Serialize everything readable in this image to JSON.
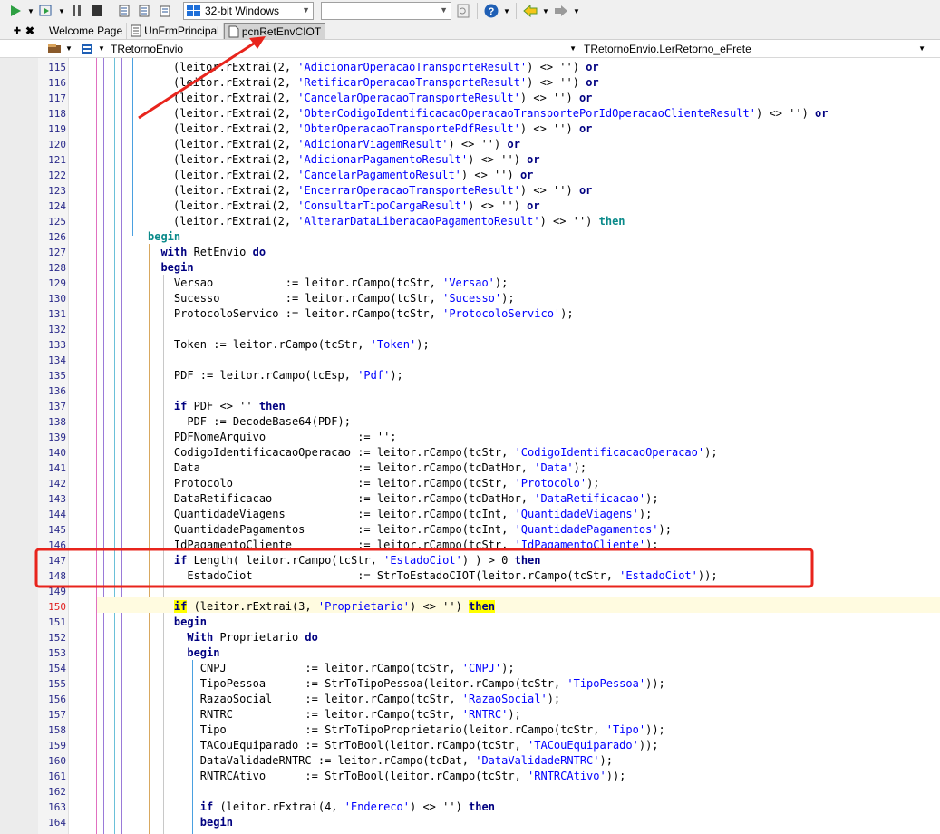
{
  "toolbar": {
    "platform": "32-bit Windows",
    "config_value": ""
  },
  "tabs": [
    {
      "label": "Welcome Page"
    },
    {
      "label": "UnFrmPrincipal"
    },
    {
      "label": "pcnRetEnvCIOT"
    }
  ],
  "navbar": {
    "class": "TRetornoEnvio",
    "method": "TRetornoEnvio.LerRetorno_eFrete"
  },
  "editor": {
    "line_numbers": [
      "115",
      "116",
      "117",
      "118",
      "119",
      "120",
      "121",
      "122",
      "123",
      "124",
      "125",
      "126",
      "127",
      "128",
      "129",
      "130",
      "131",
      "132",
      "133",
      "134",
      "135",
      "136",
      "137",
      "138",
      "139",
      "140",
      "141",
      "142",
      "143",
      "144",
      "145",
      "146",
      "147",
      "148",
      "149",
      "150",
      "151",
      "152",
      "153",
      "154",
      "155",
      "156",
      "157",
      "158",
      "159",
      "160",
      "161",
      "162",
      "163",
      "164"
    ],
    "lines": [
      [
        [
          "t",
          "(leitor.rExtrai(2, "
        ],
        [
          "s",
          "'AdicionarOperacaoTransporteResult'"
        ],
        [
          "t",
          ") <> '') "
        ],
        [
          "k",
          "or"
        ]
      ],
      [
        [
          "t",
          "(leitor.rExtrai(2, "
        ],
        [
          "s",
          "'RetificarOperacaoTransporteResult'"
        ],
        [
          "t",
          ") <> '') "
        ],
        [
          "k",
          "or"
        ]
      ],
      [
        [
          "t",
          "(leitor.rExtrai(2, "
        ],
        [
          "s",
          "'CancelarOperacaoTransporteResult'"
        ],
        [
          "t",
          ") <> '') "
        ],
        [
          "k",
          "or"
        ]
      ],
      [
        [
          "t",
          "(leitor.rExtrai(2, "
        ],
        [
          "s",
          "'ObterCodigoIdentificacaoOperacaoTransportePorIdOperacaoClienteResult'"
        ],
        [
          "t",
          ") <> '') "
        ],
        [
          "k",
          "or"
        ]
      ],
      [
        [
          "t",
          "(leitor.rExtrai(2, "
        ],
        [
          "s",
          "'ObterOperacaoTransportePdfResult'"
        ],
        [
          "t",
          ") <> '') "
        ],
        [
          "k",
          "or"
        ]
      ],
      [
        [
          "t",
          "(leitor.rExtrai(2, "
        ],
        [
          "s",
          "'AdicionarViagemResult'"
        ],
        [
          "t",
          ") <> '') "
        ],
        [
          "k",
          "or"
        ]
      ],
      [
        [
          "t",
          "(leitor.rExtrai(2, "
        ],
        [
          "s",
          "'AdicionarPagamentoResult'"
        ],
        [
          "t",
          ") <> '') "
        ],
        [
          "k",
          "or"
        ]
      ],
      [
        [
          "t",
          "(leitor.rExtrai(2, "
        ],
        [
          "s",
          "'CancelarPagamentoResult'"
        ],
        [
          "t",
          ") <> '') "
        ],
        [
          "k",
          "or"
        ]
      ],
      [
        [
          "t",
          "(leitor.rExtrai(2, "
        ],
        [
          "s",
          "'EncerrarOperacaoTransporteResult'"
        ],
        [
          "t",
          ") <> '') "
        ],
        [
          "k",
          "or"
        ]
      ],
      [
        [
          "t",
          "(leitor.rExtrai(2, "
        ],
        [
          "s",
          "'ConsultarTipoCargaResult'"
        ],
        [
          "t",
          ") <> '') "
        ],
        [
          "k",
          "or"
        ]
      ],
      [
        [
          "t",
          "(leitor.rExtrai(2, "
        ],
        [
          "s",
          "'AlterarDataLiberacaoPagamentoResult'"
        ],
        [
          "t",
          ") <> '') "
        ],
        [
          "c",
          "then"
        ]
      ],
      [
        [
          "c",
          "begin"
        ]
      ],
      [
        [
          "t",
          "  "
        ],
        [
          "k",
          "with"
        ],
        [
          "t",
          " RetEnvio "
        ],
        [
          "k",
          "do"
        ]
      ],
      [
        [
          "t",
          "  "
        ],
        [
          "k",
          "begin"
        ]
      ],
      [
        [
          "t",
          "    Versao           := leitor.rCampo(tcStr, "
        ],
        [
          "s",
          "'Versao'"
        ],
        [
          "t",
          ");"
        ]
      ],
      [
        [
          "t",
          "    Sucesso          := leitor.rCampo(tcStr, "
        ],
        [
          "s",
          "'Sucesso'"
        ],
        [
          "t",
          ");"
        ]
      ],
      [
        [
          "t",
          "    ProtocoloServico := leitor.rCampo(tcStr, "
        ],
        [
          "s",
          "'ProtocoloServico'"
        ],
        [
          "t",
          ");"
        ]
      ],
      [],
      [
        [
          "t",
          "    Token := leitor.rCampo(tcStr, "
        ],
        [
          "s",
          "'Token'"
        ],
        [
          "t",
          ");"
        ]
      ],
      [],
      [
        [
          "t",
          "    PDF := leitor.rCampo(tcEsp, "
        ],
        [
          "s",
          "'Pdf'"
        ],
        [
          "t",
          ");"
        ]
      ],
      [],
      [
        [
          "t",
          "    "
        ],
        [
          "k",
          "if"
        ],
        [
          "t",
          " PDF <> '' "
        ],
        [
          "k",
          "then"
        ]
      ],
      [
        [
          "t",
          "      PDF := DecodeBase64(PDF);"
        ]
      ],
      [
        [
          "t",
          "    PDFNomeArquivo              := '';"
        ]
      ],
      [
        [
          "t",
          "    CodigoIdentificacaoOperacao := leitor.rCampo(tcStr, "
        ],
        [
          "s",
          "'CodigoIdentificacaoOperacao'"
        ],
        [
          "t",
          ");"
        ]
      ],
      [
        [
          "t",
          "    Data                        := leitor.rCampo(tcDatHor, "
        ],
        [
          "s",
          "'Data'"
        ],
        [
          "t",
          ");"
        ]
      ],
      [
        [
          "t",
          "    Protocolo                   := leitor.rCampo(tcStr, "
        ],
        [
          "s",
          "'Protocolo'"
        ],
        [
          "t",
          ");"
        ]
      ],
      [
        [
          "t",
          "    DataRetificacao             := leitor.rCampo(tcDatHor, "
        ],
        [
          "s",
          "'DataRetificacao'"
        ],
        [
          "t",
          ");"
        ]
      ],
      [
        [
          "t",
          "    QuantidadeViagens           := leitor.rCampo(tcInt, "
        ],
        [
          "s",
          "'QuantidadeViagens'"
        ],
        [
          "t",
          ");"
        ]
      ],
      [
        [
          "t",
          "    QuantidadePagamentos        := leitor.rCampo(tcInt, "
        ],
        [
          "s",
          "'QuantidadePagamentos'"
        ],
        [
          "t",
          ");"
        ]
      ],
      [
        [
          "t",
          "    IdPagamentoCliente          := leitor.rCampo(tcStr, "
        ],
        [
          "s",
          "'IdPagamentoCliente'"
        ],
        [
          "t",
          ");"
        ]
      ],
      [
        [
          "t",
          "    "
        ],
        [
          "k",
          "if"
        ],
        [
          "t",
          " Length( leitor.rCampo(tcStr, "
        ],
        [
          "s",
          "'EstadoCiot'"
        ],
        [
          "t",
          ") ) > 0 "
        ],
        [
          "k",
          "then"
        ]
      ],
      [
        [
          "t",
          "      EstadoCiot                := StrToEstadoCIOT(leitor.rCampo(tcStr, "
        ],
        [
          "s",
          "'EstadoCiot'"
        ],
        [
          "t",
          "));"
        ]
      ],
      [],
      [
        [
          "t",
          "    "
        ],
        [
          "h",
          "if"
        ],
        [
          "t",
          " (leitor.rExtrai(3, "
        ],
        [
          "s",
          "'Proprietario'"
        ],
        [
          "t",
          ") <> '') "
        ],
        [
          "h",
          "then"
        ]
      ],
      [
        [
          "t",
          "    "
        ],
        [
          "k",
          "begin"
        ]
      ],
      [
        [
          "t",
          "      "
        ],
        [
          "k",
          "With"
        ],
        [
          "t",
          " Proprietario "
        ],
        [
          "k",
          "do"
        ]
      ],
      [
        [
          "t",
          "      "
        ],
        [
          "k",
          "begin"
        ]
      ],
      [
        [
          "t",
          "        CNPJ            := leitor.rCampo(tcStr, "
        ],
        [
          "s",
          "'CNPJ'"
        ],
        [
          "t",
          ");"
        ]
      ],
      [
        [
          "t",
          "        TipoPessoa      := StrToTipoPessoa(leitor.rCampo(tcStr, "
        ],
        [
          "s",
          "'TipoPessoa'"
        ],
        [
          "t",
          "));"
        ]
      ],
      [
        [
          "t",
          "        RazaoSocial     := leitor.rCampo(tcStr, "
        ],
        [
          "s",
          "'RazaoSocial'"
        ],
        [
          "t",
          ");"
        ]
      ],
      [
        [
          "t",
          "        RNTRC           := leitor.rCampo(tcStr, "
        ],
        [
          "s",
          "'RNTRC'"
        ],
        [
          "t",
          ");"
        ]
      ],
      [
        [
          "t",
          "        Tipo            := StrToTipoProprietario(leitor.rCampo(tcStr, "
        ],
        [
          "s",
          "'Tipo'"
        ],
        [
          "t",
          "));"
        ]
      ],
      [
        [
          "t",
          "        TACouEquiparado := StrToBool(leitor.rCampo(tcStr, "
        ],
        [
          "s",
          "'TACouEquiparado'"
        ],
        [
          "t",
          "));"
        ]
      ],
      [
        [
          "t",
          "        DataValidadeRNTRC := leitor.rCampo(tcDat, "
        ],
        [
          "s",
          "'DataValidadeRNTRC'"
        ],
        [
          "t",
          ");"
        ]
      ],
      [
        [
          "t",
          "        RNTRCAtivo      := StrToBool(leitor.rCampo(tcStr, "
        ],
        [
          "s",
          "'RNTRCAtivo'"
        ],
        [
          "t",
          "));"
        ]
      ],
      [],
      [
        [
          "t",
          "        "
        ],
        [
          "k",
          "if"
        ],
        [
          "t",
          " (leitor.rExtrai(4, "
        ],
        [
          "s",
          "'Endereco'"
        ],
        [
          "t",
          ") <> '') "
        ],
        [
          "k",
          "then"
        ]
      ],
      [
        [
          "t",
          "        "
        ],
        [
          "k",
          "begin"
        ]
      ]
    ]
  },
  "colors": {
    "annotation": "#e8241c",
    "keyword": "#000080",
    "string": "#0000ff",
    "highlight": "#ffff00"
  }
}
